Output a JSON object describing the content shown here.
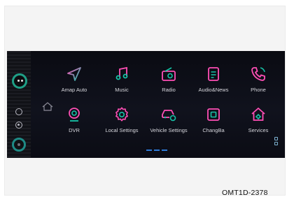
{
  "colors": {
    "accent_cyan": "#16c4a8",
    "accent_pink": "#ff4fb5",
    "accent_blue": "#2e7bd9",
    "label": "#d7d7dd"
  },
  "apps_row_1": [
    {
      "label": "Amap Auto",
      "icon": "navigation-arrow-icon"
    },
    {
      "label": "Music",
      "icon": "music-note-icon"
    },
    {
      "label": "Radio",
      "icon": "radio-icon"
    },
    {
      "label": "Audio&News",
      "icon": "audio-news-icon"
    },
    {
      "label": "Phone",
      "icon": "phone-icon"
    }
  ],
  "apps_row_2": [
    {
      "label": "DVR",
      "icon": "dvr-camera-icon"
    },
    {
      "label": "Local Settings",
      "icon": "gear-icon"
    },
    {
      "label": "Vehicle Settings",
      "icon": "car-settings-icon"
    },
    {
      "label": "ChangBa",
      "icon": "changba-icon"
    },
    {
      "label": "Services",
      "icon": "services-home-icon"
    }
  ],
  "caption": "OMT1D-2378"
}
